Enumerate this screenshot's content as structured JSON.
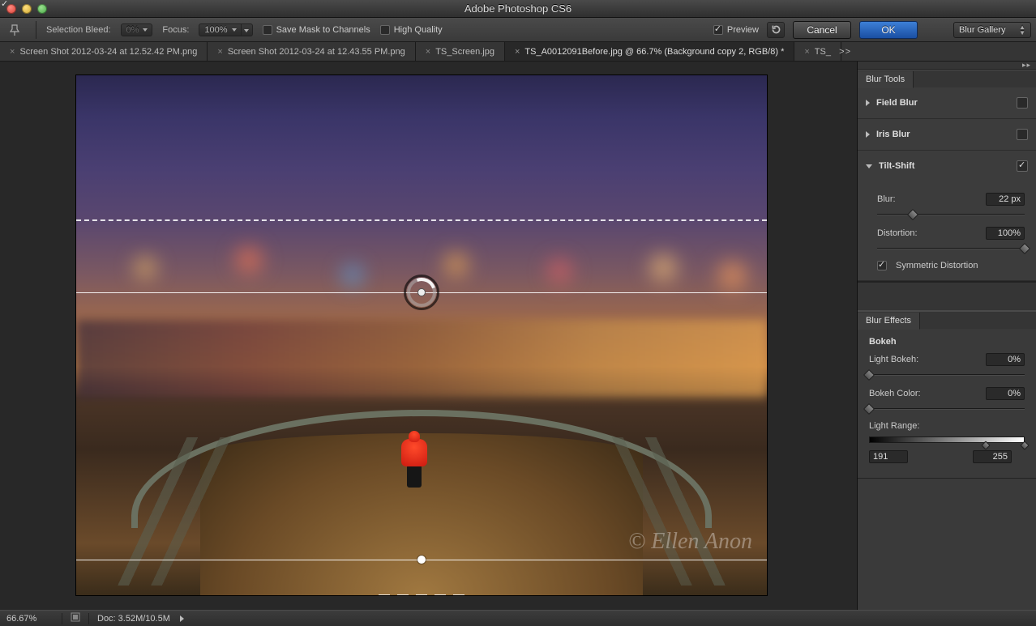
{
  "app_title": "Adobe Photoshop CS6",
  "optionsbar": {
    "selection_bleed_label": "Selection Bleed:",
    "selection_bleed_value": "0%",
    "focus_label": "Focus:",
    "focus_value": "100%",
    "save_mask_label": "Save Mask to Channels",
    "high_quality_label": "High Quality",
    "preview_label": "Preview",
    "cancel": "Cancel",
    "ok": "OK",
    "workspace": "Blur Gallery"
  },
  "tabs": [
    "Screen Shot 2012-03-24 at 12.52.42 PM.png",
    "Screen Shot 2012-03-24 at 12.43.55 PM.png",
    "TS_Screen.jpg",
    "TS_A0012091Before.jpg @ 66.7% (Background copy 2, RGB/8) *",
    "TS_"
  ],
  "active_tab_index": 3,
  "watermark": "© Ellen Anon",
  "panels": {
    "blur_tools_tab": "Blur Tools",
    "field_blur": {
      "label": "Field Blur",
      "enabled": false
    },
    "iris_blur": {
      "label": "Iris Blur",
      "enabled": false
    },
    "tilt_shift": {
      "label": "Tilt-Shift",
      "enabled": true,
      "expanded": true,
      "blur_label": "Blur:",
      "blur_value": "22 px",
      "blur_pct": 24,
      "distortion_label": "Distortion:",
      "distortion_value": "100%",
      "distortion_pct": 100,
      "sym_label": "Symmetric Distortion",
      "sym_checked": true
    },
    "blur_effects_tab": "Blur Effects",
    "bokeh": {
      "label": "Bokeh",
      "enabled": true,
      "light_bokeh_label": "Light Bokeh:",
      "light_bokeh_value": "0%",
      "light_bokeh_pct": 0,
      "bokeh_color_label": "Bokeh Color:",
      "bokeh_color_value": "0%",
      "bokeh_color_pct": 0,
      "light_range_label": "Light Range:",
      "light_range_low": "191",
      "light_range_high": "255",
      "light_range_low_pct": 75,
      "light_range_high_pct": 100
    }
  },
  "statusbar": {
    "zoom": "66.67%",
    "doc_info": "Doc: 3.52M/10.5M"
  }
}
